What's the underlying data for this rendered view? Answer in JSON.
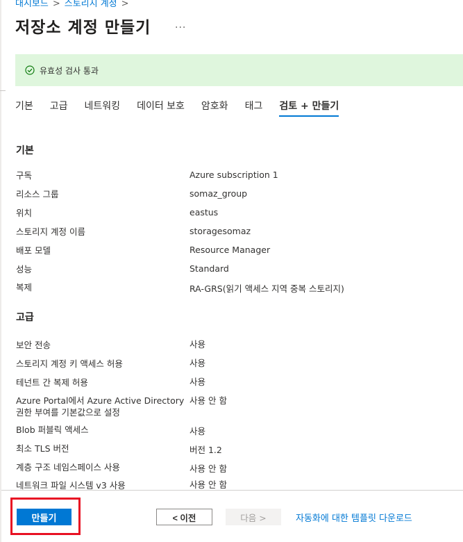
{
  "breadcrumb": [
    "대시보드",
    "스토리지 계정"
  ],
  "page_title": "저장소 계정 만들기",
  "more_label": "...",
  "validation": {
    "text": "유효성 검사 통과",
    "icon": "check-circle-icon",
    "color": "#107c10"
  },
  "tabs": [
    {
      "label": "기본"
    },
    {
      "label": "고급"
    },
    {
      "label": "네트워킹"
    },
    {
      "label": "데이터 보호"
    },
    {
      "label": "암호화"
    },
    {
      "label": "태그"
    },
    {
      "label": "검토 + 만들기",
      "active": true
    }
  ],
  "sections": {
    "basic": {
      "title": "기본",
      "rows": [
        {
          "label": "구독",
          "value": "Azure subscription 1"
        },
        {
          "label": "리소스 그룹",
          "value": "somaz_group"
        },
        {
          "label": "위치",
          "value": "eastus"
        },
        {
          "label": "스토리지 계정 이름",
          "value": "storagesomaz"
        },
        {
          "label": "배포 모델",
          "value": "Resource Manager"
        },
        {
          "label": "성능",
          "value": "Standard"
        },
        {
          "label": "복제",
          "value": "RA-GRS(읽기 액세스 지역 중복 스토리지)"
        }
      ]
    },
    "advanced": {
      "title": "고급",
      "rows": [
        {
          "label": "보안 전송",
          "value": "사용"
        },
        {
          "label": "스토리지 계정 키 액세스 허용",
          "value": "사용"
        },
        {
          "label": "테넌트 간 복제 허용",
          "value": "사용"
        },
        {
          "label": "Azure Portal에서 Azure Active Directory 권한 부여를 기본값으로 설정",
          "value": "사용 안 함"
        },
        {
          "label": "Blob 퍼블릭 액세스",
          "value": "사용"
        },
        {
          "label": "최소 TLS 버전",
          "value": "버전 1.2"
        },
        {
          "label": "계층 구조 네임스페이스 사용",
          "value": "사용 안 함"
        },
        {
          "label": "네트워크 파일 시스템 v3 사용",
          "value": "사용 안 함"
        }
      ]
    }
  },
  "footer": {
    "create_label": "만들기",
    "prev_label": "< 이전",
    "next_label": "다음 >",
    "download_link": "자동화에 대한 템플릿 다운로드"
  },
  "colors": {
    "accent": "#0078d4",
    "highlight": "#e81123",
    "banner_bg": "#dff6dd"
  }
}
